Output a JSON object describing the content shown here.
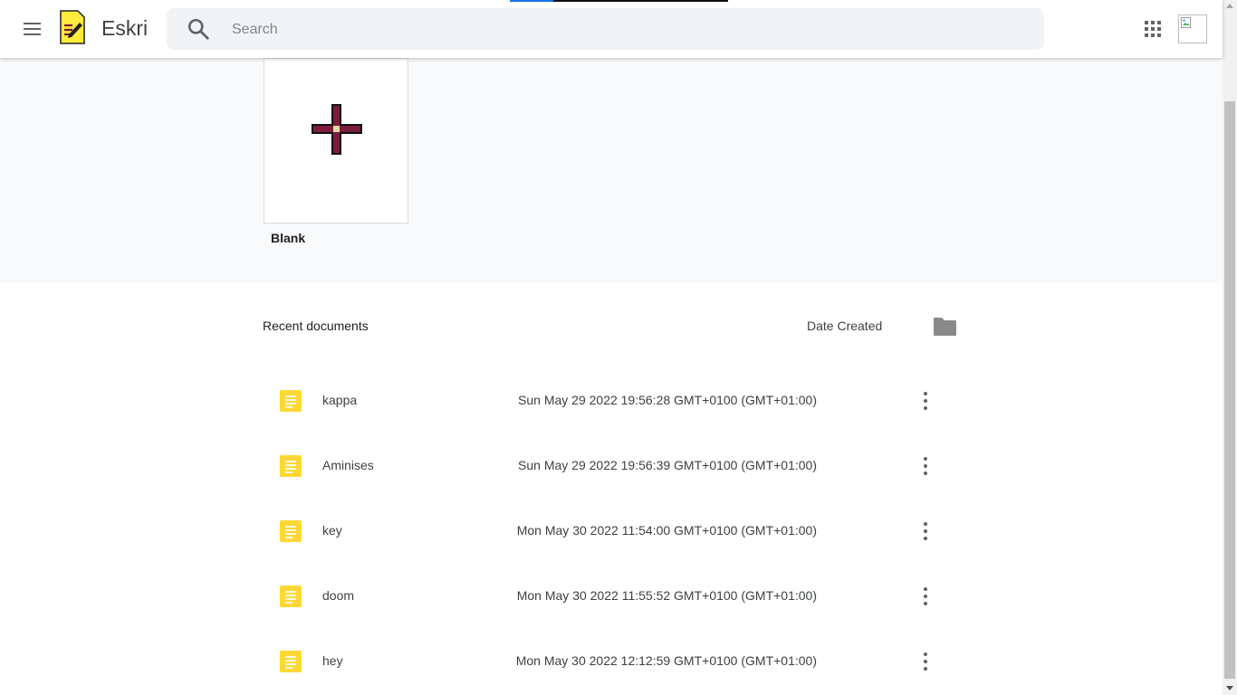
{
  "header": {
    "app_title": "Eskri",
    "search_placeholder": "Search",
    "loading_progress": 0.2
  },
  "templates": {
    "blank_label": "Blank"
  },
  "recent": {
    "title": "Recent documents",
    "sort_label": "Date Created",
    "documents": [
      {
        "name": "kappa",
        "date": "Sun May 29 2022 19:56:28 GMT+0100 (GMT+01:00)"
      },
      {
        "name": "Aminises",
        "date": "Sun May 29 2022 19:56:39 GMT+0100 (GMT+01:00)"
      },
      {
        "name": "key",
        "date": "Mon May 30 2022 11:54:00 GMT+0100 (GMT+01:00)"
      },
      {
        "name": "doom",
        "date": "Mon May 30 2022 11:55:52 GMT+0100 (GMT+01:00)"
      },
      {
        "name": "hey",
        "date": "Mon May 30 2022 12:12:59 GMT+0100 (GMT+01:00)"
      }
    ]
  },
  "icons": {
    "menu": "menu-icon",
    "logo": "note-pencil-logo",
    "search": "search-icon",
    "apps": "apps-grid-icon",
    "avatar": "broken-image-avatar",
    "plus": "plus-icon",
    "folder": "folder-icon",
    "document": "document-icon",
    "more": "more-vert-icon"
  },
  "colors": {
    "doc_icon": "#fdd835",
    "plus_fill": "#7b1c3c",
    "plus_center": "#e8d9a0",
    "progress_fill": "#1a73e8",
    "template_band": "#f8f9fa"
  }
}
